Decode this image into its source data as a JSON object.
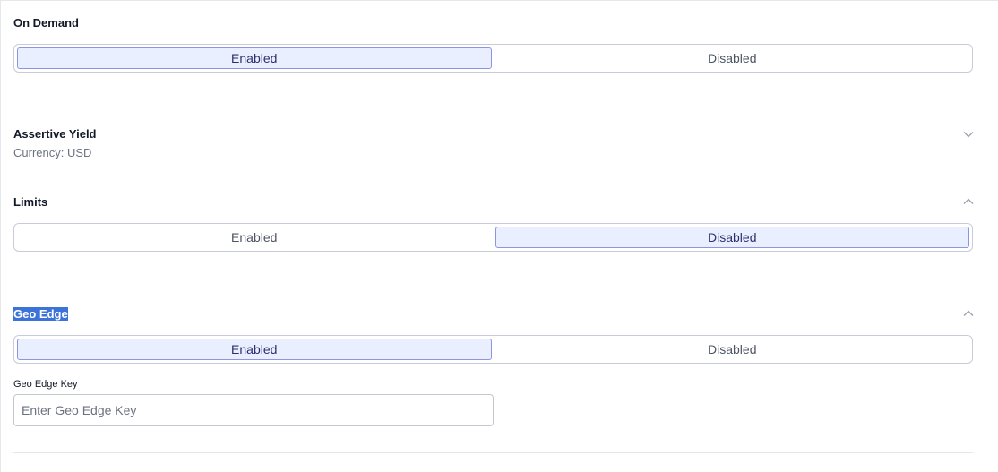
{
  "on_demand": {
    "title": "On Demand",
    "options": [
      "Enabled",
      "Disabled"
    ],
    "selected": "Enabled"
  },
  "assertive_yield": {
    "title": "Assertive Yield",
    "subtitle": "Currency: USD",
    "chevron_icon": "chevron-down-icon"
  },
  "limits": {
    "title": "Limits",
    "options": [
      "Enabled",
      "Disabled"
    ],
    "selected": "Disabled",
    "chevron_icon": "chevron-up-icon"
  },
  "geo_edge": {
    "title": "Geo Edge",
    "options": [
      "Enabled",
      "Disabled"
    ],
    "selected": "Enabled",
    "chevron_icon": "chevron-up-icon",
    "key_label": "Geo Edge Key",
    "key_value": "",
    "key_placeholder": "Enter Geo Edge Key"
  },
  "colors": {
    "active_bg": "#eaefff",
    "active_border": "#8b95e0",
    "highlight": "#3b73d9"
  }
}
